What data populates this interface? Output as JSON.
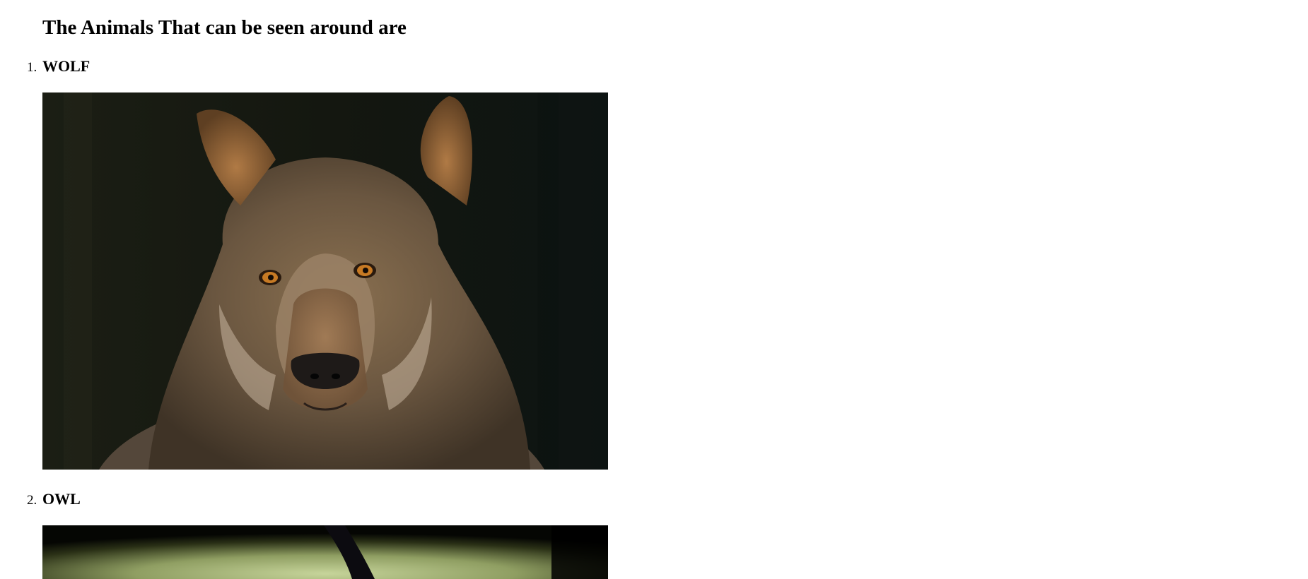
{
  "page": {
    "title": "The Animals That can be seen around are"
  },
  "animals": [
    {
      "number": "1.",
      "name": "WOLF",
      "image": "wolf-portrait-photo"
    },
    {
      "number": "2.",
      "name": "OWL",
      "image": "owl-photo"
    }
  ]
}
